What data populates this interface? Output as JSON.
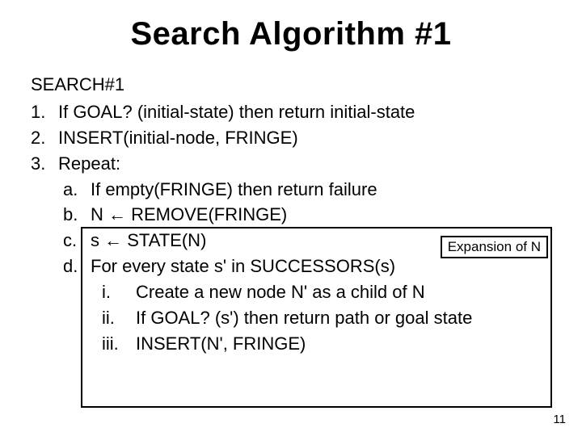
{
  "title": "Search Algorithm #1",
  "heading": "SEARCH#1",
  "steps": {
    "s1": "If GOAL? (initial-state) then return initial-state",
    "s2": "INSERT(initial-node, FRINGE)",
    "s3": "Repeat:",
    "a": "If empty(FRINGE) then return failure",
    "b": "N ← REMOVE(FRINGE)",
    "c": "s ← STATE(N)",
    "d": "For every state s' in SUCCESSORS(s)",
    "i": "Create a new node N' as a child of N",
    "ii": "If GOAL? (s') then return path or goal state",
    "iii": "INSERT(N', FRINGE)"
  },
  "box_label": "Expansion of N",
  "page_number": "11"
}
